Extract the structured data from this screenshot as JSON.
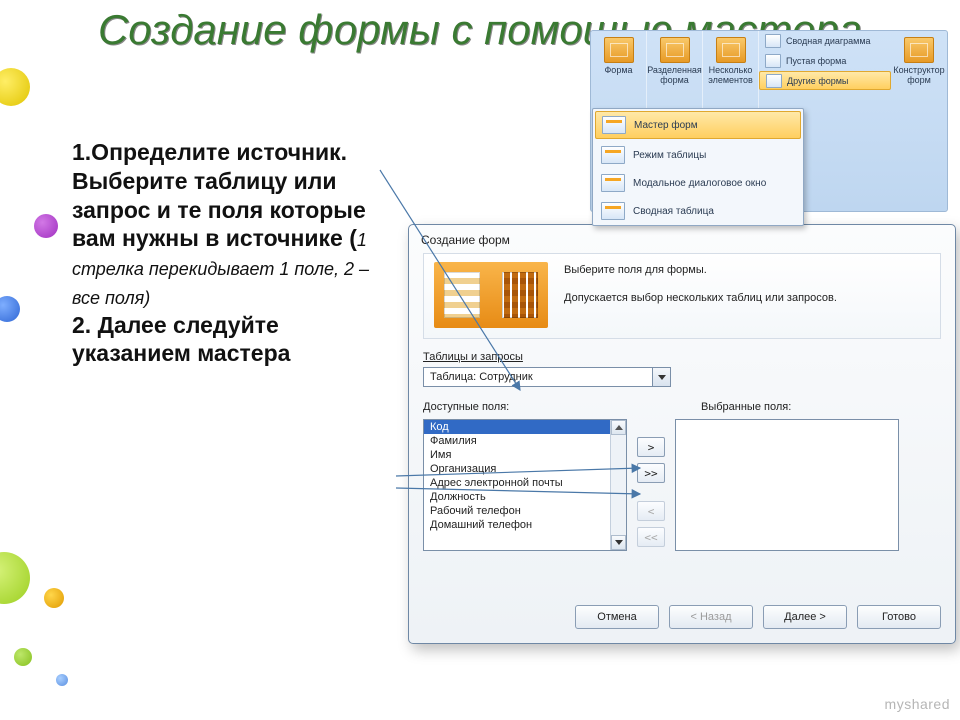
{
  "title": "Создание формы с помощью мастера",
  "body": {
    "p1_pre": "1.Определите источник. Выберите таблицу или запрос и те поля которые вам нужны в источнике (",
    "p1_small": "1 стрелка перекидывает 1 поле, 2 – все поля)",
    "p2": "2.  Далее следуйте указанием мастера"
  },
  "ribbon": {
    "big": [
      {
        "label": "Форма"
      },
      {
        "label": "Разделенная форма"
      },
      {
        "label": "Несколько элементов"
      }
    ],
    "side": [
      {
        "label": "Сводная диаграмма"
      },
      {
        "label": "Пустая форма"
      },
      {
        "label": "Другие формы",
        "highlight": true
      }
    ],
    "last": {
      "label": "Конструктор форм"
    },
    "flyout": [
      {
        "label": "Мастер форм",
        "selected": true
      },
      {
        "label": "Режим таблицы"
      },
      {
        "label": "Модальное диалоговое окно"
      },
      {
        "label": "Сводная таблица"
      }
    ]
  },
  "dialog": {
    "title": "Создание форм",
    "banner_line1": "Выберите поля для формы.",
    "banner_line2": "Допускается выбор нескольких таблиц или запросов.",
    "tables_label": "Таблицы и запросы",
    "combo_value": "Таблица: Сотрудник",
    "avail_label": "Доступные поля:",
    "selected_label": "Выбранные поля:",
    "fields": [
      "Код",
      "Фамилия",
      "Имя",
      "Организация",
      "Адрес электронной почты",
      "Должность",
      "Рабочий телефон",
      "Домашний телефон"
    ],
    "move": {
      "one": ">",
      "all": ">>",
      "back_one": "<",
      "back_all": "<<"
    },
    "buttons": {
      "cancel": "Отмена",
      "back": "< Назад",
      "next": "Далее >",
      "finish": "Готово"
    }
  },
  "watermark": "myshared"
}
